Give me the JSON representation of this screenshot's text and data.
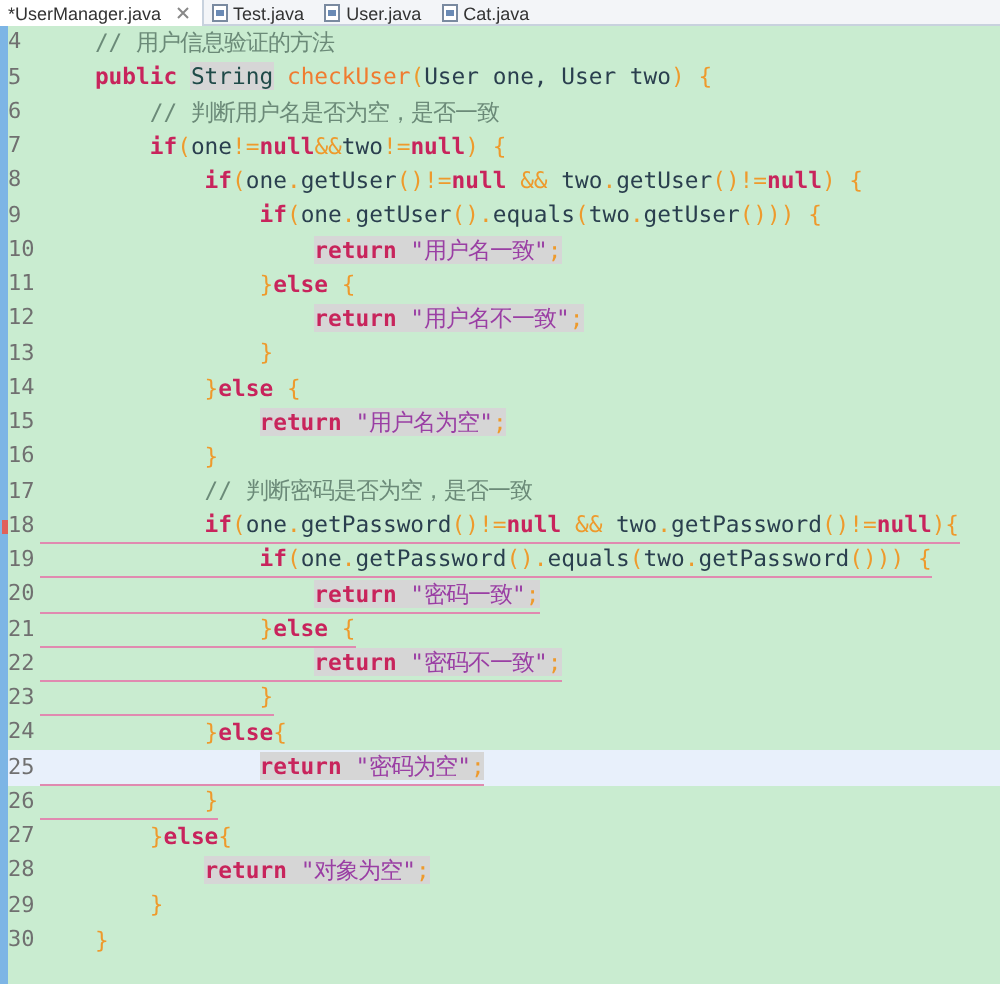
{
  "tabs": [
    {
      "label": "*UserManager.java",
      "selected": true,
      "closable": true
    },
    {
      "label": "Test.java",
      "selected": false,
      "closable": false
    },
    {
      "label": "User.java",
      "selected": false,
      "closable": false
    },
    {
      "label": "Cat.java",
      "selected": false,
      "closable": false
    }
  ],
  "editor": {
    "lines": [
      {
        "number": "4",
        "tokens": [
          {
            "kind": "comment",
            "text": "    // 用户信息验证的方法"
          }
        ]
      },
      {
        "number": "5",
        "tokens": [
          {
            "kind": "keyword",
            "text": "    public "
          },
          {
            "kind": "type",
            "text": "String",
            "marked": true
          },
          {
            "kind": "method",
            "text": " checkUser"
          },
          {
            "kind": "punct",
            "text": "("
          },
          {
            "kind": "plain",
            "text": "User one, User two"
          },
          {
            "kind": "punct",
            "text": ") {"
          }
        ]
      },
      {
        "number": "6",
        "tokens": [
          {
            "kind": "comment",
            "text": "        // 判断用户名是否为空，是否一致"
          }
        ]
      },
      {
        "number": "7",
        "tokens": [
          {
            "kind": "keyword",
            "text": "        if"
          },
          {
            "kind": "punct",
            "text": "("
          },
          {
            "kind": "plain",
            "text": "one"
          },
          {
            "kind": "punct",
            "text": "!="
          },
          {
            "kind": "keyword",
            "text": "null"
          },
          {
            "kind": "punct",
            "text": "&&"
          },
          {
            "kind": "plain",
            "text": "two"
          },
          {
            "kind": "punct",
            "text": "!="
          },
          {
            "kind": "keyword",
            "text": "null"
          },
          {
            "kind": "punct",
            "text": ") {"
          }
        ]
      },
      {
        "number": "8",
        "tokens": [
          {
            "kind": "keyword",
            "text": "            if"
          },
          {
            "kind": "punct",
            "text": "("
          },
          {
            "kind": "plain",
            "text": "one"
          },
          {
            "kind": "punct",
            "text": "."
          },
          {
            "kind": "plain",
            "text": "getUser"
          },
          {
            "kind": "punct",
            "text": "()!="
          },
          {
            "kind": "keyword",
            "text": "null "
          },
          {
            "kind": "punct",
            "text": "&&"
          },
          {
            "kind": "plain",
            "text": " two"
          },
          {
            "kind": "punct",
            "text": "."
          },
          {
            "kind": "plain",
            "text": "getUser"
          },
          {
            "kind": "punct",
            "text": "()!="
          },
          {
            "kind": "keyword",
            "text": "null"
          },
          {
            "kind": "punct",
            "text": ") {"
          }
        ]
      },
      {
        "number": "9",
        "tokens": [
          {
            "kind": "keyword",
            "text": "                if"
          },
          {
            "kind": "punct",
            "text": "("
          },
          {
            "kind": "plain",
            "text": "one"
          },
          {
            "kind": "punct",
            "text": "."
          },
          {
            "kind": "plain",
            "text": "getUser"
          },
          {
            "kind": "punct",
            "text": "()."
          },
          {
            "kind": "plain",
            "text": "equals"
          },
          {
            "kind": "punct",
            "text": "("
          },
          {
            "kind": "plain",
            "text": "two"
          },
          {
            "kind": "punct",
            "text": "."
          },
          {
            "kind": "plain",
            "text": "getUser"
          },
          {
            "kind": "punct",
            "text": "())) {"
          }
        ]
      },
      {
        "number": "10",
        "tokens": [
          {
            "kind": "keyword",
            "text": "                    return ",
            "marked": true
          },
          {
            "kind": "string",
            "text": "\"用户名一致\"",
            "marked": true
          },
          {
            "kind": "punct",
            "text": ";",
            "marked": true
          }
        ]
      },
      {
        "number": "11",
        "tokens": [
          {
            "kind": "punct",
            "text": "                }"
          },
          {
            "kind": "keyword",
            "text": "else"
          },
          {
            "kind": "punct",
            "text": " {"
          }
        ]
      },
      {
        "number": "12",
        "tokens": [
          {
            "kind": "keyword",
            "text": "                    return ",
            "marked": true
          },
          {
            "kind": "string",
            "text": "\"用户名不一致\"",
            "marked": true
          },
          {
            "kind": "punct",
            "text": ";",
            "marked": true
          }
        ]
      },
      {
        "number": "13",
        "tokens": [
          {
            "kind": "punct",
            "text": "                }"
          }
        ]
      },
      {
        "number": "14",
        "tokens": [
          {
            "kind": "punct",
            "text": "            }"
          },
          {
            "kind": "keyword",
            "text": "else"
          },
          {
            "kind": "punct",
            "text": " {"
          }
        ]
      },
      {
        "number": "15",
        "tokens": [
          {
            "kind": "keyword",
            "text": "                return ",
            "marked": true
          },
          {
            "kind": "string",
            "text": "\"用户名为空\"",
            "marked": true
          },
          {
            "kind": "punct",
            "text": ";",
            "marked": true
          }
        ]
      },
      {
        "number": "16",
        "tokens": [
          {
            "kind": "punct",
            "text": "            }"
          }
        ]
      },
      {
        "number": "17",
        "tokens": [
          {
            "kind": "comment",
            "text": "            // 判断密码是否为空，是否一致"
          }
        ]
      },
      {
        "number": "18",
        "flagged": true,
        "marker": true,
        "tokens": [
          {
            "kind": "keyword",
            "text": "            if"
          },
          {
            "kind": "punct",
            "text": "("
          },
          {
            "kind": "plain",
            "text": "one"
          },
          {
            "kind": "punct",
            "text": "."
          },
          {
            "kind": "plain",
            "text": "getPassword"
          },
          {
            "kind": "punct",
            "text": "()!="
          },
          {
            "kind": "keyword",
            "text": "null "
          },
          {
            "kind": "punct",
            "text": "&&"
          },
          {
            "kind": "plain",
            "text": " two"
          },
          {
            "kind": "punct",
            "text": "."
          },
          {
            "kind": "plain",
            "text": "getPassword"
          },
          {
            "kind": "punct",
            "text": "()!="
          },
          {
            "kind": "keyword",
            "text": "null"
          },
          {
            "kind": "punct",
            "text": "){"
          }
        ]
      },
      {
        "number": "19",
        "flagged": true,
        "tokens": [
          {
            "kind": "keyword",
            "text": "                if"
          },
          {
            "kind": "punct",
            "text": "("
          },
          {
            "kind": "plain",
            "text": "one"
          },
          {
            "kind": "punct",
            "text": "."
          },
          {
            "kind": "plain",
            "text": "getPassword"
          },
          {
            "kind": "punct",
            "text": "()."
          },
          {
            "kind": "plain",
            "text": "equals"
          },
          {
            "kind": "punct",
            "text": "("
          },
          {
            "kind": "plain",
            "text": "two"
          },
          {
            "kind": "punct",
            "text": "."
          },
          {
            "kind": "plain",
            "text": "getPassword"
          },
          {
            "kind": "punct",
            "text": "())) {"
          }
        ]
      },
      {
        "number": "20",
        "flagged": true,
        "tokens": [
          {
            "kind": "keyword",
            "text": "                    return ",
            "marked": true
          },
          {
            "kind": "string",
            "text": "\"密码一致\"",
            "marked": true
          },
          {
            "kind": "punct",
            "text": ";",
            "marked": true
          }
        ]
      },
      {
        "number": "21",
        "flagged": true,
        "tokens": [
          {
            "kind": "punct",
            "text": "                }"
          },
          {
            "kind": "keyword",
            "text": "else"
          },
          {
            "kind": "punct",
            "text": " {"
          }
        ]
      },
      {
        "number": "22",
        "flagged": true,
        "tokens": [
          {
            "kind": "keyword",
            "text": "                    return ",
            "marked": true
          },
          {
            "kind": "string",
            "text": "\"密码不一致\"",
            "marked": true
          },
          {
            "kind": "punct",
            "text": ";",
            "marked": true
          }
        ]
      },
      {
        "number": "23",
        "flagged": true,
        "tokens": [
          {
            "kind": "punct",
            "text": "                }"
          }
        ]
      },
      {
        "number": "24",
        "flagged": true,
        "tokens": [
          {
            "kind": "punct",
            "text": "            }"
          },
          {
            "kind": "keyword",
            "text": "else"
          },
          {
            "kind": "punct",
            "text": "{"
          }
        ]
      },
      {
        "number": "25",
        "flagged": true,
        "current": true,
        "tokens": [
          {
            "kind": "keyword",
            "text": "                return ",
            "marked": true
          },
          {
            "kind": "string",
            "text": "\"密码为空\"",
            "marked": true
          },
          {
            "kind": "punct",
            "text": ";",
            "marked": true
          }
        ]
      },
      {
        "number": "26",
        "flagged": true,
        "tokens": [
          {
            "kind": "punct",
            "text": "            }"
          }
        ]
      },
      {
        "number": "27",
        "tokens": [
          {
            "kind": "punct",
            "text": "        }"
          },
          {
            "kind": "keyword",
            "text": "else"
          },
          {
            "kind": "punct",
            "text": "{"
          }
        ]
      },
      {
        "number": "28",
        "tokens": [
          {
            "kind": "keyword",
            "text": "            return ",
            "marked": true
          },
          {
            "kind": "string",
            "text": "\"对象为空\"",
            "marked": true
          },
          {
            "kind": "punct",
            "text": ";",
            "marked": true
          }
        ]
      },
      {
        "number": "29",
        "tokens": [
          {
            "kind": "punct",
            "text": "        }"
          }
        ]
      },
      {
        "number": "30",
        "tokens": [
          {
            "kind": "punct",
            "text": "    }"
          }
        ]
      }
    ]
  }
}
